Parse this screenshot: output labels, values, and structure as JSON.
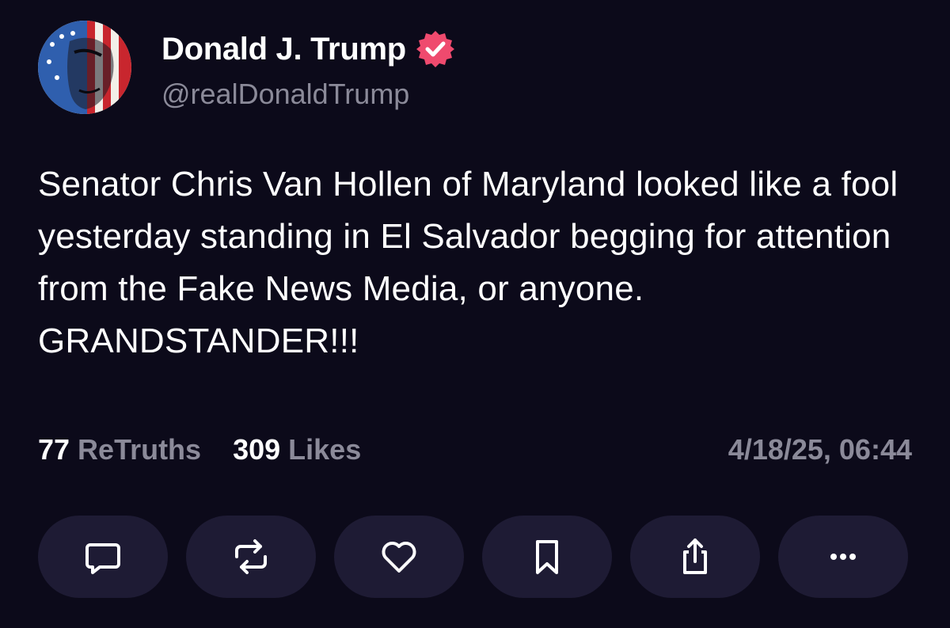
{
  "post": {
    "author": {
      "display_name": "Donald J. Trump",
      "handle": "@realDonaldTrump",
      "verified": true,
      "verified_color": "#ef4a6e"
    },
    "text": "Senator Chris Van Hollen of Maryland looked like a fool yesterday standing in El Salvador begging for attention from the Fake News Media, or anyone. GRANDSTANDER!!!",
    "stats": {
      "retruths_count": "77",
      "retruths_label": "ReTruths",
      "likes_count": "309",
      "likes_label": "Likes"
    },
    "timestamp": "4/18/25, 06:44"
  },
  "actions": [
    {
      "name": "reply",
      "icon": "comment-icon"
    },
    {
      "name": "retruth",
      "icon": "repost-icon"
    },
    {
      "name": "like",
      "icon": "heart-icon"
    },
    {
      "name": "bookmark",
      "icon": "bookmark-icon"
    },
    {
      "name": "share",
      "icon": "share-icon"
    },
    {
      "name": "more",
      "icon": "more-icon"
    }
  ],
  "colors": {
    "background": "#0c0a1a",
    "button_background": "#1e1b34",
    "muted_text": "#8b8a99",
    "text": "#ffffff"
  }
}
